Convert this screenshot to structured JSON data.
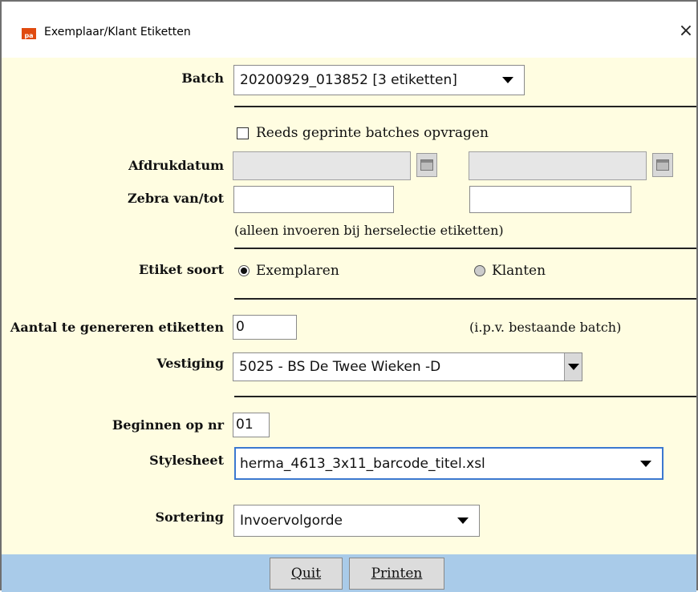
{
  "window": {
    "title": "Exemplaar/Klant Etiketten",
    "close_symbol": "×",
    "icon_text": "pa"
  },
  "form": {
    "batch_label": "Batch",
    "batch_value": "20200929_013852 [3 etiketten]",
    "reprinted_checkbox_label": "Reeds geprinte batches opvragen",
    "reprinted_checked": false,
    "print_date_label": "Afdrukdatum",
    "print_date_from": "",
    "print_date_to": "",
    "zebra_label": "Zebra van/tot",
    "zebra_from": "",
    "zebra_to": "",
    "zebra_note": "(alleen invoeren bij herselectie etiketten)",
    "label_type_label": "Etiket soort",
    "label_type_options": [
      "Exemplaren",
      "Klanten"
    ],
    "label_type_selected": "Exemplaren",
    "count_label": "Aantal te genereren etiketten",
    "count_value": "0",
    "count_note": "(i.p.v. bestaande batch)",
    "branch_label": "Vestiging",
    "branch_value": "5025 - BS De Twee Wieken -D",
    "start_label": "Beginnen op nr",
    "start_value": "01",
    "stylesheet_label": "Stylesheet",
    "stylesheet_value": "herma_4613_3x11_barcode_titel.xsl",
    "sort_label": "Sortering",
    "sort_value": "Invoervolgorde"
  },
  "footer": {
    "quit_label": "Quit",
    "print_label": "Printen"
  },
  "colors": {
    "background": "#fffde1",
    "footer": "#a9cbe9",
    "icon": "#e04a0f"
  }
}
